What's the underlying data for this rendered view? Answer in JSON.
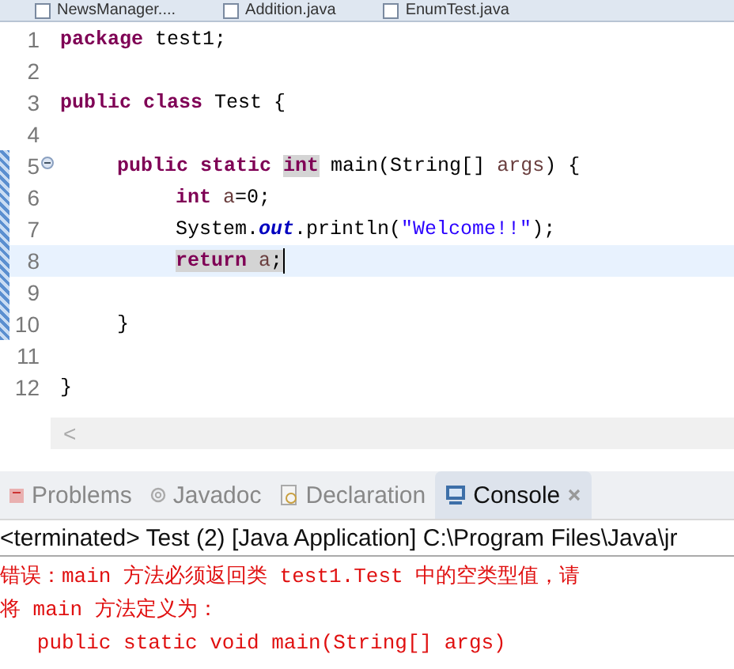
{
  "editor_tabs": [
    {
      "label": "NewsManager...."
    },
    {
      "label": "Addition.java"
    },
    {
      "label": "EnumTest.java"
    }
  ],
  "code_lines": [
    {
      "number": "1",
      "kind": "top",
      "current": false,
      "foldable": false,
      "tokens": [
        {
          "kind": "keyword",
          "text": "package",
          "highlighted": false
        },
        {
          "kind": "plain",
          "text": " test1;",
          "highlighted": false
        }
      ]
    },
    {
      "number": "2",
      "current": false,
      "foldable": false
    },
    {
      "number": "3",
      "kind": "top",
      "current": false,
      "foldable": false,
      "tokens": [
        {
          "kind": "keyword",
          "text": "public class",
          "highlighted": false
        },
        {
          "kind": "plain",
          "text": " Test {",
          "highlighted": false
        }
      ]
    },
    {
      "number": "4",
      "current": false,
      "foldable": false
    },
    {
      "number": "5",
      "kind": "member",
      "current": false,
      "foldable": true,
      "tokens": [
        {
          "kind": "keyword",
          "text": "public static ",
          "highlighted": false
        },
        {
          "kind": "keyword",
          "text": "int",
          "highlighted": true
        },
        {
          "kind": "plain",
          "text": " main(String[] ",
          "highlighted": false
        },
        {
          "kind": "variable",
          "text": "args",
          "highlighted": false
        },
        {
          "kind": "plain",
          "text": ") {",
          "highlighted": false
        }
      ]
    },
    {
      "number": "6",
      "kind": "statement",
      "current": false,
      "foldable": false,
      "tokens": [
        {
          "kind": "keyword",
          "text": "int ",
          "highlighted": false
        },
        {
          "kind": "variable",
          "text": "a",
          "highlighted": false
        },
        {
          "kind": "plain",
          "text": "=0;",
          "highlighted": false
        }
      ]
    },
    {
      "number": "7",
      "kind": "statement",
      "current": false,
      "foldable": false,
      "tokens": [
        {
          "kind": "plain",
          "text": "System.",
          "highlighted": false
        },
        {
          "kind": "field",
          "text": "out",
          "highlighted": false
        },
        {
          "kind": "plain",
          "text": ".println(",
          "highlighted": false
        },
        {
          "kind": "string",
          "text": "\"Welcome!!\"",
          "highlighted": false
        },
        {
          "kind": "plain",
          "text": ");",
          "highlighted": false
        }
      ]
    },
    {
      "number": "8",
      "kind": "statement",
      "current": true,
      "foldable": false,
      "tokens": [
        {
          "kind": "keyword",
          "text": "return",
          "highlighted": true
        },
        {
          "kind": "variable",
          "text": " a",
          "highlighted": true
        },
        {
          "kind": "plain",
          "text": ";",
          "highlighted": true
        }
      ]
    },
    {
      "number": "9",
      "current": false,
      "foldable": false
    },
    {
      "number": "10",
      "kind": "member",
      "current": false,
      "foldable": false,
      "tokens": [
        {
          "kind": "plain",
          "text": "}",
          "highlighted": false
        }
      ]
    },
    {
      "number": "11",
      "current": false,
      "foldable": false
    },
    {
      "number": "12",
      "kind": "top",
      "current": false,
      "foldable": false,
      "tokens": [
        {
          "kind": "plain",
          "text": "}",
          "highlighted": false
        }
      ]
    }
  ],
  "scroll_left": "<",
  "panel_tabs": [
    {
      "label": "Problems",
      "kind": "problems",
      "selected": false
    },
    {
      "label": "Javadoc",
      "kind": "javadoc",
      "selected": false
    },
    {
      "label": "Declaration",
      "kind": "declaration",
      "selected": false
    },
    {
      "label": "Console",
      "kind": "console",
      "selected": true
    }
  ],
  "console": {
    "header": "<terminated> Test (2) [Java Application] C:\\Program Files\\Java\\jr",
    "lines": [
      "错误：main 方法必须返回类 test1.Test 中的空类型值，请",
      "将 main 方法定义为：",
      "   public static void main(String[] args)"
    ]
  }
}
